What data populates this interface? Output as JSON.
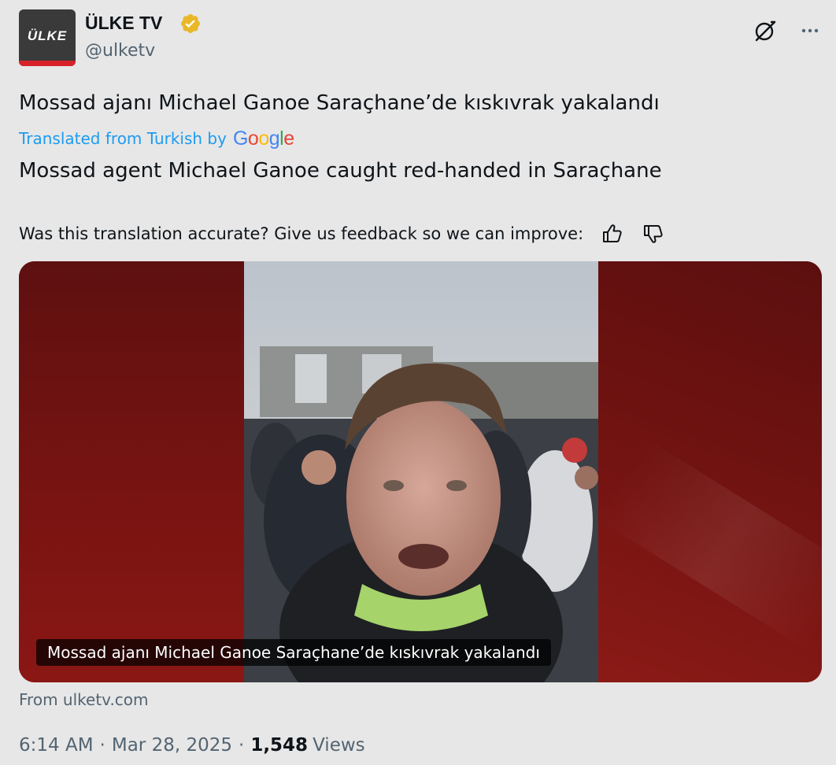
{
  "author": {
    "display_name": "ÜLKE TV",
    "handle": "@ulketv",
    "avatar_text": "ÜLKE",
    "verified": true,
    "verified_color": "#e8b829"
  },
  "header_actions": {
    "grok_icon": "grok-icon",
    "more_icon": "more-icon"
  },
  "tweet": {
    "original_text": "Mossad ajanı Michael Ganoe Saraçhane’de kıskıvrak yakalandı",
    "translated_label": "Translated from Turkish by",
    "translation_provider": "Google",
    "translated_text": "Mossad agent Michael Ganoe caught red-handed in Saraçhane",
    "feedback_prompt": "Was this translation accurate? Give us feedback so we can improve:"
  },
  "media": {
    "caption": "Mossad ajanı Michael Ganoe Saraçhane’de kıskıvrak yakalandı",
    "background_color": "#7a1412"
  },
  "source": "From ulketv.com",
  "meta": {
    "time": "6:14 AM",
    "date": "Mar 28, 2025",
    "views_count": "1,548",
    "views_label": "Views"
  },
  "colors": {
    "link_blue": "#1d9bf0",
    "secondary_text": "#536471",
    "primary_text": "#0f1419"
  }
}
